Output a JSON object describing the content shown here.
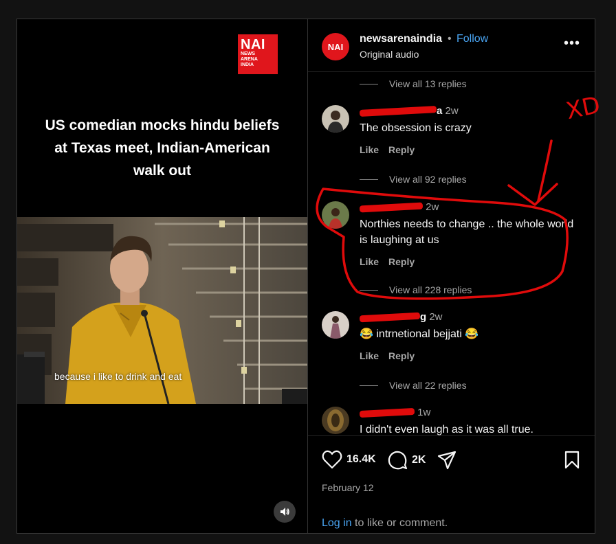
{
  "video": {
    "logo_big": "NAI",
    "logo_small_1": "NEWS",
    "logo_small_2": "ARENA",
    "logo_small_3": "INDIA",
    "headline": "US comedian mocks hindu beliefs at Texas meet, Indian-American walk out",
    "caption": "because i like to drink and eat",
    "sound_icon": "speaker-icon"
  },
  "header": {
    "avatar_text": "NAI",
    "username": "newsarenaindia",
    "separator": "•",
    "follow": "Follow",
    "audio": "Original audio",
    "more": "•••"
  },
  "comments": {
    "replies_1": "View all 13 replies",
    "c1": {
      "user_visible": "a",
      "time": "2w",
      "text": "The obsession is crazy",
      "like": "Like",
      "reply": "Reply"
    },
    "replies_2": "View all 92 replies",
    "c2": {
      "user_visible": "",
      "time": "2w",
      "text": "Northies needs to change .. the whole world is laughing at us",
      "like": "Like",
      "reply": "Reply"
    },
    "replies_3": "View all 228 replies",
    "c3": {
      "user_visible": "g",
      "time": "2w",
      "text": "😂 intrnetional bejjati 😂",
      "like": "Like",
      "reply": "Reply"
    },
    "replies_4": "View all 22 replies",
    "c4": {
      "user_visible": "",
      "time": "1w",
      "text": "I didn't even laugh as it was all true."
    }
  },
  "actions": {
    "likes": "16.4K",
    "comments": "2K",
    "date": "February 12",
    "login_link": "Log in",
    "login_rest": " to like or comment."
  },
  "annotation": {
    "scribble_text": "XD",
    "color": "#e00b0b"
  },
  "colors": {
    "accent": "#4aa6f5",
    "brand_red": "#e0161c",
    "background": "#000000"
  }
}
